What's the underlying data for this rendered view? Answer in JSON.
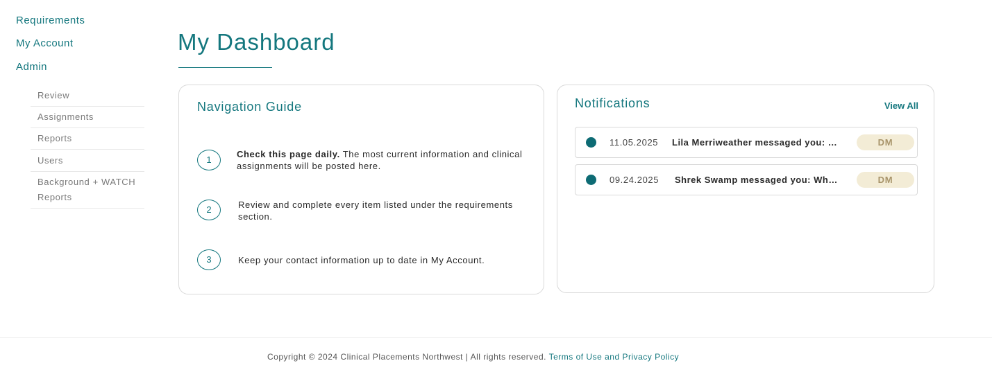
{
  "sidebar": {
    "main_items": [
      {
        "label": "Requirements"
      },
      {
        "label": "My Account"
      },
      {
        "label": "Admin"
      }
    ],
    "admin_items": [
      {
        "label": "Review"
      },
      {
        "label": "Assignments"
      },
      {
        "label": "Reports"
      },
      {
        "label": "Users"
      },
      {
        "label": "Background + WATCH Reports"
      }
    ]
  },
  "main": {
    "title": "My Dashboard"
  },
  "navigation_guide": {
    "title": "Navigation Guide",
    "steps": [
      {
        "number": "1",
        "bold": "Check this page daily.",
        "text": " The most current information and clinical assignments will be posted here."
      },
      {
        "number": "2",
        "bold": "",
        "text": "Review and complete every item listed under the requirements section."
      },
      {
        "number": "3",
        "bold": "",
        "text": "Keep your contact information up to date in My Account."
      }
    ]
  },
  "notifications": {
    "title": "Notifications",
    "view_all_label": "View All",
    "items": [
      {
        "date": "11.05.2025",
        "message": "Lila Merriweather messaged you: …",
        "badge": "DM"
      },
      {
        "date": "09.24.2025",
        "message": "Shrek Swamp messaged you: Wh…",
        "badge": "DM"
      }
    ]
  },
  "footer": {
    "copyright": "Copyright © 2024 Clinical Placements Northwest | All rights reserved.",
    "link_label": "Terms of Use and Privacy Policy"
  },
  "colors": {
    "accent": "#14777e",
    "dot": "#0d6b74",
    "badge_bg": "#f3ecd6",
    "badge_text": "#a8946a"
  }
}
